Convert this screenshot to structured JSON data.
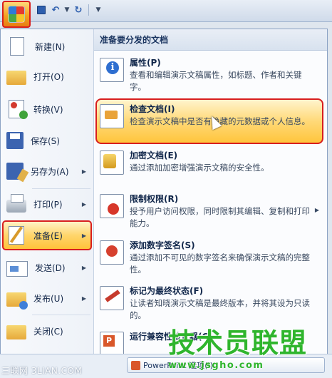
{
  "titlebar": {
    "icons": [
      "office-logo-icon",
      "save-icon",
      "undo-icon",
      "dropdown-icon",
      "redo-icon",
      "customize-dropdown-icon"
    ]
  },
  "menu": {
    "left_items": [
      {
        "label": "新建(N)",
        "icon": "new-document-icon",
        "has_submenu": false
      },
      {
        "label": "打开(O)",
        "icon": "open-folder-icon",
        "has_submenu": false
      },
      {
        "label": "转换(V)",
        "icon": "convert-icon",
        "has_submenu": false
      },
      {
        "label": "保存(S)",
        "icon": "save-disk-icon",
        "has_submenu": false
      },
      {
        "label": "另存为(A)",
        "icon": "save-as-icon",
        "has_submenu": true
      },
      {
        "label": "打印(P)",
        "icon": "printer-icon",
        "has_submenu": true
      },
      {
        "label": "准备(E)",
        "icon": "prepare-icon",
        "has_submenu": true
      },
      {
        "label": "发送(D)",
        "icon": "send-icon",
        "has_submenu": true
      },
      {
        "label": "发布(U)",
        "icon": "publish-icon",
        "has_submenu": true
      },
      {
        "label": "关闭(C)",
        "icon": "close-folder-icon",
        "has_submenu": false
      }
    ],
    "panel_title": "准备要分发的文档",
    "right_items": [
      {
        "title": "属性(P)",
        "desc": "查看和编辑演示文稿属性，如标题、作者和关键字。",
        "icon": "properties-icon"
      },
      {
        "title": "检查文档(I)",
        "desc": "检查演示文稿中是否有隐藏的元数据或个人信息。",
        "icon": "inspect-document-icon"
      },
      {
        "title": "加密文档(E)",
        "desc": "通过添加加密增强演示文稿的安全性。",
        "icon": "encrypt-lock-icon"
      },
      {
        "title": "限制权限(R)",
        "desc": "授予用户访问权限，同时限制其编辑、复制和打印能力。",
        "icon": "restrict-permission-icon"
      },
      {
        "title": "添加数字签名(S)",
        "desc": "通过添加不可见的数字签名来确保演示文稿的完整性。",
        "icon": "digital-signature-icon"
      },
      {
        "title": "标记为最终状态(F)",
        "desc": "让读者知晓演示文稿是最终版本，并将其设为只读的。",
        "icon": "mark-final-icon"
      },
      {
        "title": "运行兼容性检查器(C)",
        "desc": "",
        "icon": "compatibility-checker-icon"
      }
    ]
  },
  "bottom": {
    "button_label": "PowerPoint 选项(I)",
    "watermark_left": "三联网 3LIAN.COM",
    "watermark_logo": "技术员联盟",
    "watermark_url": "www.jsgho.com"
  },
  "colors": {
    "highlight_border": "#d81e1e",
    "highlight_fill": "#ffd56b",
    "watermark_green": "#2fb52d"
  }
}
